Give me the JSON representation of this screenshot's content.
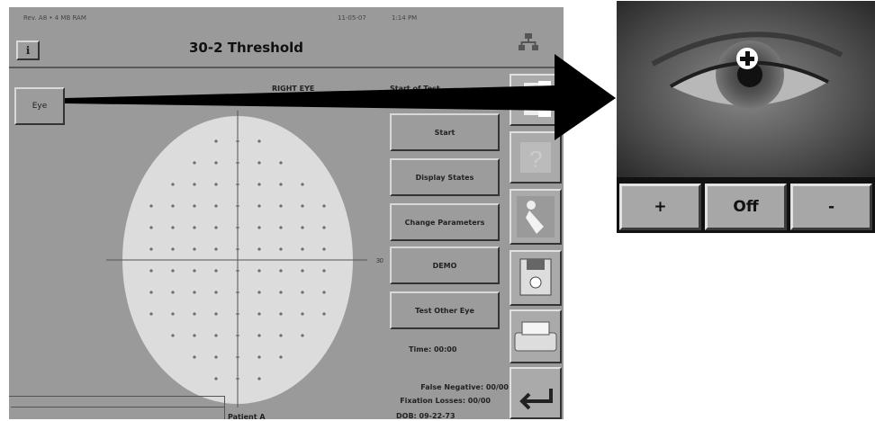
{
  "status_bar": {
    "version": "Rev. A8 • 4 MB RAM",
    "date": "11-05-07",
    "time": "1:14 PM"
  },
  "header": {
    "title": "30-2 Threshold",
    "help_label": "ℹ"
  },
  "eye_button": "Eye",
  "eye_label": "RIGHT EYE",
  "test_state": "Start of Test",
  "actions": [
    "Start",
    "Display States",
    "Change Parameters",
    "DEMO",
    "Test Other Eye"
  ],
  "test_time": "Time: 00:00",
  "false_negative": "False Negative: 00/00",
  "fixation_losses": "Fixation Losses: 00/00",
  "patient": "Patient A",
  "dob": "DOB: 09-22-73",
  "field": {
    "axis_left": "30",
    "axis_right": "30"
  },
  "camera_buttons": {
    "plus": "+",
    "off": "Off",
    "minus": "-"
  },
  "icons": [
    "help-icon",
    "network-icon",
    "info-icon",
    "question-icon",
    "person-icon",
    "floppy-disk-icon",
    "printer-icon",
    "return-arrow-icon",
    "fixation-cross-icon"
  ]
}
